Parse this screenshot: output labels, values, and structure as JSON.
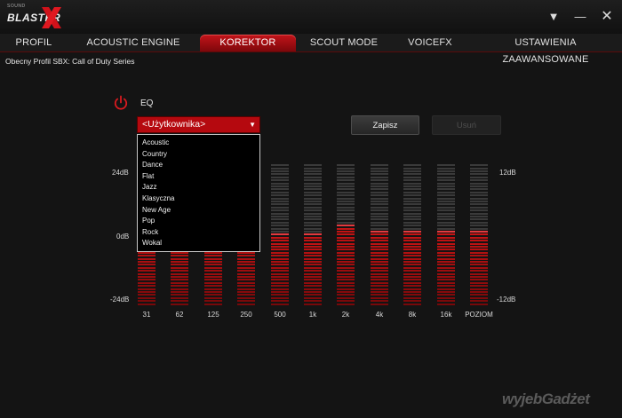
{
  "app": {
    "logo_small": "SOUND",
    "logo_main": "BLASTER",
    "accent": "#c4141a"
  },
  "window": {
    "dropdown_glyph": "▼",
    "minimize_glyph": "—",
    "close_glyph": "✕"
  },
  "tabs": [
    {
      "label": "PROFIL",
      "active": false
    },
    {
      "label": "ACOUSTIC ENGINE",
      "active": false
    },
    {
      "label": "KOREKTOR",
      "active": true
    },
    {
      "label": "SCOUT MODE",
      "active": false
    },
    {
      "label": "VOICEFX",
      "active": false
    },
    {
      "label": "USTAWIENIA ZAAWANSOWANE",
      "active": false
    }
  ],
  "profile_line": "Obecny Profil SBX: Call of Duty Series",
  "eq": {
    "label": "EQ",
    "power_icon": "power-icon",
    "preset_selected": "<Użytkownika>",
    "preset_options": [
      "Acoustic",
      "Country",
      "Dance",
      "Flat",
      "Jazz",
      "Klasyczna",
      "New Age",
      "Pop",
      "Rock",
      "Wokal"
    ],
    "save_label": "Zapisz",
    "delete_label": "Usuń",
    "left_axis": {
      "top": "24dB",
      "mid": "0dB",
      "bottom": "-24dB"
    },
    "right_axis": {
      "top": "12dB",
      "bottom": "-12dB"
    },
    "bands": [
      {
        "label": "31",
        "level": 0.5
      },
      {
        "label": "62",
        "level": 0.5
      },
      {
        "label": "125",
        "level": 0.5
      },
      {
        "label": "250",
        "level": 0.5
      },
      {
        "label": "500",
        "level": 0.5
      },
      {
        "label": "1k",
        "level": 0.5
      },
      {
        "label": "2k",
        "level": 0.58
      },
      {
        "label": "4k",
        "level": 0.54
      },
      {
        "label": "8k",
        "level": 0.54
      },
      {
        "label": "16k",
        "level": 0.54
      },
      {
        "label": "POZIOM",
        "level": 0.54
      }
    ]
  },
  "watermark": "wyjebGadżet"
}
